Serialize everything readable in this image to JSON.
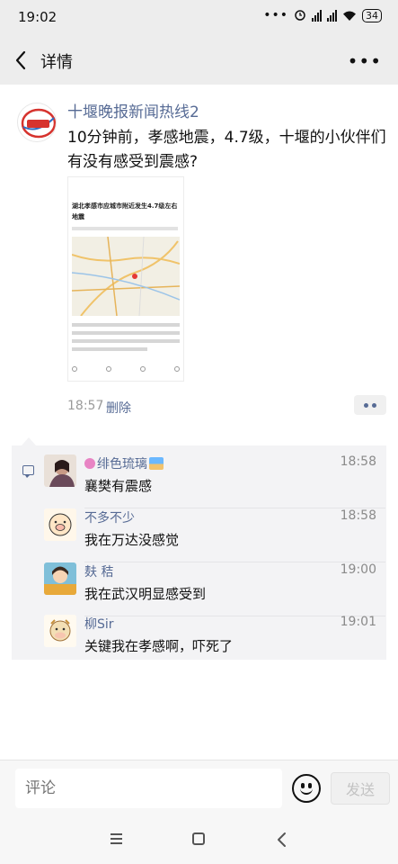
{
  "status_bar": {
    "time": "19:02",
    "battery": "34",
    "icons": [
      "dots-icon",
      "alarm-icon",
      "hd-signal-icon",
      "hd-signal-icon",
      "wifi-icon",
      "battery-icon"
    ]
  },
  "nav": {
    "title": "详情",
    "icons": [
      "back-arrow-icon",
      "more-icon"
    ]
  },
  "post": {
    "author": "十堰晚报新闻热线2",
    "text": "10分钟前，孝感地震，4.7级，十堰的小伙伴们有没有感受到震感?",
    "time": "18:57",
    "delete_label": "删除",
    "image": {
      "headline": "湖北孝感市应城市附近发生4.7级左右地震",
      "body": "中国地震台网自动测定：12月26日18时38分在湖北孝感市应城市附近（北纬30.85度，东经113.43度）发生4.7级左右地震，最终结果以正式速报为准。"
    }
  },
  "comments": [
    {
      "name": "绯色琉璃",
      "time": "18:58",
      "text": "襄樊有震感",
      "avatar": "photo-avatar"
    },
    {
      "name": "不多不少",
      "time": "18:58",
      "text": "我在万达没感觉",
      "avatar": "cartoon-pig-avatar"
    },
    {
      "name": "麸 秸",
      "time": "19:00",
      "text": "我在武汉明显感受到",
      "avatar": "cartoon-girl-avatar"
    },
    {
      "name": "柳Sir",
      "time": "19:01",
      "text": "关键我在孝感啊，吓死了",
      "avatar": "cartoon-cow-avatar"
    }
  ],
  "input": {
    "placeholder": "评论",
    "send_label": "发送",
    "icons": [
      "emoji-icon"
    ]
  },
  "colors": {
    "link": "#576b95",
    "bar_bg": "#ededed",
    "comment_bg": "#f3f3f5"
  }
}
